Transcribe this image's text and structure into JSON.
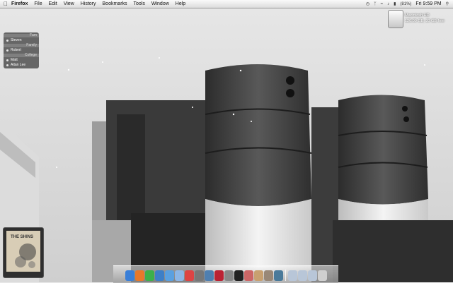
{
  "menubar": {
    "app_name": "Firefox",
    "items": [
      "File",
      "Edit",
      "View",
      "History",
      "Bookmarks",
      "Tools",
      "Window",
      "Help"
    ],
    "battery": "(81%)",
    "clock": "Fri 9:59 PM",
    "status_icons": [
      "time-machine-icon",
      "bluetooth-icon",
      "wifi-icon",
      "volume-icon",
      "battery-icon",
      "spotlight-icon"
    ]
  },
  "desktop": {
    "disk_name": "Macintosh HD",
    "disk_info": "120.09 GB, 30 GB free"
  },
  "buddy_list": {
    "groups": [
      {
        "name": "Fam",
        "members": [
          "Steven"
        ]
      },
      {
        "name": "Family",
        "members": [
          "Robert"
        ]
      },
      {
        "name": "College",
        "members": [
          "Matt",
          "Aitan Lee"
        ]
      }
    ]
  },
  "album": {
    "title": "THE SHINS"
  },
  "dock": {
    "apps": [
      {
        "name": "finder-icon",
        "color": "#3a7fd8"
      },
      {
        "name": "firefox-icon",
        "color": "#e8782a"
      },
      {
        "name": "adium-icon",
        "color": "#3cb04a"
      },
      {
        "name": "safari-icon",
        "color": "#3d7fc7"
      },
      {
        "name": "ichat-icon",
        "color": "#5aa0e0"
      },
      {
        "name": "mail-icon",
        "color": "#8cb6e6"
      },
      {
        "name": "ical-icon",
        "color": "#d44"
      },
      {
        "name": "preview-icon",
        "color": "#777"
      },
      {
        "name": "itunes-icon",
        "color": "#4f7fb0"
      },
      {
        "name": "photobooth-icon",
        "color": "#b23"
      },
      {
        "name": "system-preferences-icon",
        "color": "#888"
      },
      {
        "name": "terminal-icon",
        "color": "#222"
      },
      {
        "name": "camino-icon",
        "color": "#c66"
      },
      {
        "name": "textedit-icon",
        "color": "#c8a070"
      },
      {
        "name": "dictionary-icon",
        "color": "#987"
      },
      {
        "name": "timemachine-icon",
        "color": "#4a7a9a"
      }
    ],
    "folders": [
      {
        "name": "documents-folder-icon",
        "color": "#b8c6d8"
      },
      {
        "name": "downloads-folder-icon",
        "color": "#b8c6d8"
      },
      {
        "name": "applications-folder-icon",
        "color": "#b8c6d8"
      },
      {
        "name": "trash-icon",
        "color": "#cfcfcf"
      }
    ]
  }
}
